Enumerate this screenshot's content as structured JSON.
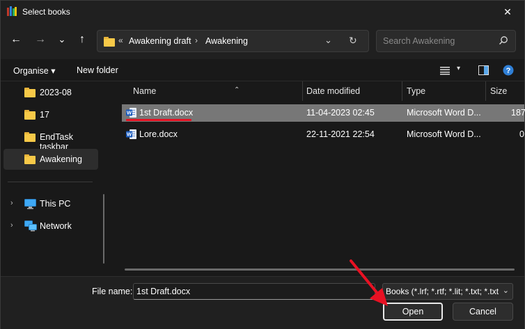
{
  "window": {
    "title": "Select books",
    "close_glyph": "✕"
  },
  "nav": {
    "back_glyph": "←",
    "forward_glyph": "→",
    "recent_glyph": "⌄",
    "up_glyph": "↑",
    "address": {
      "overflow": "«",
      "crumbs": [
        "Awakening draft",
        "Awakening"
      ],
      "separator": "›",
      "dropdown_glyph": "⌄",
      "refresh_glyph": "↻"
    },
    "search_placeholder": "Search Awakening"
  },
  "commands": {
    "organise": "Organise ▾",
    "new_folder": "New folder"
  },
  "sidebar": {
    "folders": [
      "2023-08",
      "17",
      "EndTask taskbar",
      "Awakening"
    ],
    "selected": "Awakening",
    "locations": [
      {
        "label": "This PC",
        "icon": "pc-icon"
      },
      {
        "label": "Network",
        "icon": "network-icon"
      }
    ],
    "expand_glyph": "›"
  },
  "columns": [
    "Name",
    "Date modified",
    "Type",
    "Size"
  ],
  "sort_glyph": "⌃",
  "files": [
    {
      "name": "1st Draft.docx",
      "date": "11-04-2023 02:45",
      "type": "Microsoft Word D...",
      "size": "187",
      "selected": true
    },
    {
      "name": "Lore.docx",
      "date": "22-11-2021 22:54",
      "type": "Microsoft Word D...",
      "size": "0",
      "selected": false
    }
  ],
  "footer": {
    "file_name_label": "File name:",
    "file_name_value": "1st Draft.docx",
    "filter": "Books (*.lrf; *.rtf; *.lit; *.txt; *.txt",
    "filter_glyph": "⌄",
    "open": "Open",
    "cancel": "Cancel"
  },
  "colors": {
    "accent": "#f7c948",
    "selection": "#777777",
    "annotation": "#e81123"
  }
}
